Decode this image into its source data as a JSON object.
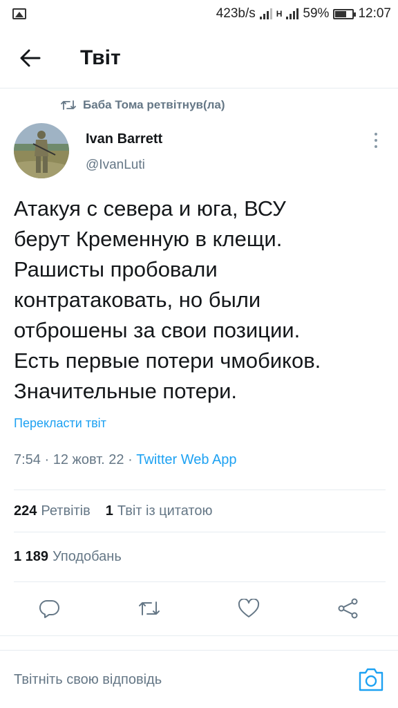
{
  "status_bar": {
    "speed": "423b/s",
    "network": "H",
    "battery": "59%",
    "time": "12:07"
  },
  "header": {
    "title": "Твіт"
  },
  "retweet_context": "Баба Тома ретвітнув(ла)",
  "tweet": {
    "author_name": "Ivan Barrett",
    "author_handle": "@IvanLuti",
    "text": "Атакуя с севера и юга, ВСУ\nберут Кременную в клещи.\nРашисты пробовали\nконтратаковать, но были\nотброшены за свои позиции.\nЕсть первые потери чмобиков.\nЗначительные потери.",
    "translate": "Перекласти твіт",
    "time": "7:54",
    "date": "12 жовт. 22",
    "source": "Twitter Web App"
  },
  "stats": {
    "retweets_count": "224",
    "retweets_label": "Ретвітів",
    "quotes_count": "1",
    "quotes_label": "Твіт із цитатою",
    "likes_count": "1 189",
    "likes_label": "Уподобань"
  },
  "reply": {
    "placeholder": "Твітніть свою відповідь"
  },
  "colors": {
    "accent": "#1da1f2",
    "secondary_text": "#657786",
    "primary_text": "#14171a",
    "divider": "#e6ecf0"
  },
  "icons": [
    "image-icon",
    "signal-icon",
    "battery-icon",
    "back-arrow-icon",
    "retweet-icon",
    "more-vertical-icon",
    "reply-icon",
    "heart-icon",
    "share-icon",
    "camera-icon"
  ]
}
